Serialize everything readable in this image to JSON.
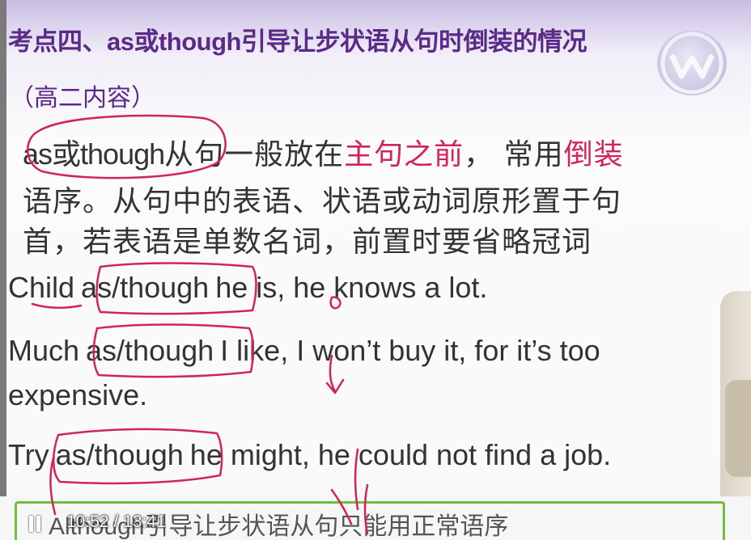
{
  "slide": {
    "title_prefix": "考点四、",
    "title_as": "as",
    "title_or": "或",
    "title_though": "though",
    "title_rest": "引导让步状语从句时倒装的情况",
    "subtitle": "（高二内容）",
    "rule_line1_a": "as或though",
    "rule_line1_b": "从句一般放在",
    "rule_line1_hl1": "主句之前",
    "rule_line1_c": "， 常用",
    "rule_line1_hl2": "倒装",
    "rule_line2": "语序。从句中的表语、状语或动词原形置于句",
    "rule_line3": "首，若表语是单数名词，前置时要省略冠词",
    "ex1_a": "Child",
    "ex1_b": "as/though",
    "ex1_c": "he is, he knows a lot.",
    "ex2_a": "Much",
    "ex2_b": "as/though",
    "ex2_c": "I like, I won’t buy it, for it’s too",
    "ex2_d": "expensive.",
    "ex3_a": "Try",
    "ex3_b": "as/though",
    "ex3_c": "he might, he could not find a job.",
    "note_en": "Although",
    "note_cn": "引导让步状语从句只能用正常语序"
  },
  "player": {
    "state": "paused",
    "current_time": "10:52",
    "separator": "/",
    "duration": "13:41",
    "pause_icon": "pause-icon"
  },
  "colors": {
    "title": "#5b2a87",
    "highlight": "#d0245a",
    "ink": "#d0245a",
    "box": "#6fbf3f"
  }
}
